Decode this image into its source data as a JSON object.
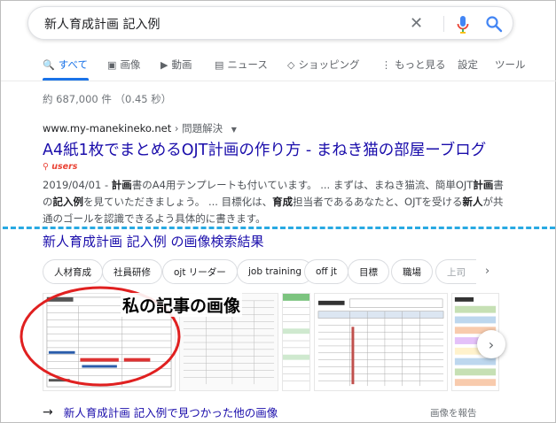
{
  "search": {
    "query": "新人育成計画 記入例",
    "clear_glyph": "✕"
  },
  "tabs": [
    {
      "label": "すべて",
      "icon": "search-icon",
      "glyph": "🔍",
      "active": true
    },
    {
      "label": "画像",
      "icon": "image-icon",
      "glyph": "▣",
      "active": false
    },
    {
      "label": "動画",
      "icon": "video-icon",
      "glyph": "▶",
      "active": false
    },
    {
      "label": "ニュース",
      "icon": "news-icon",
      "glyph": "▤",
      "active": false
    },
    {
      "label": "ショッピング",
      "icon": "tag-icon",
      "glyph": "◇",
      "active": false
    },
    {
      "label": "もっと見る",
      "icon": "more-vert-icon",
      "glyph": "⋮",
      "active": false
    },
    {
      "label": "設定",
      "active": false
    },
    {
      "label": "ツール",
      "active": false
    }
  ],
  "stats": "約 687,000 件 （0.45 秒）",
  "result": {
    "site": "www.my-manekineko.net",
    "breadcrumb": "› 問題解決",
    "caret": "▼",
    "title": "A4紙1枚でまとめるOJT計画の作り方 - まねき猫の部屋ーブログ",
    "badge": "users",
    "snippet_html": "2019/04/01 - <b>計画</b>書のA4用テンプレートも付いています。 ... まずは、まねき猫流、簡単OJT<b>計画</b>書の<b>記入例</b>を見ていただきましょう。 ... 目標化は、<b>育成</b>担当者であるあなたと、OJTを受ける<b>新人</b>が共通のゴールを認識できるよう具体的に書きます。"
  },
  "images": {
    "heading": "新人育成計画 記入例 の画像検索結果",
    "chips": [
      "人材育成",
      "社員研修",
      "ojt リーダー",
      "job training",
      "off jt",
      "目標",
      "職場",
      "上司"
    ],
    "chip_next": "›",
    "annotation": "私の記事の画像",
    "carousel_next": "›",
    "more_label": "新人育成計画 記入例で見つかった他の画像",
    "more_arrow": "→",
    "report_label": "画像を報告"
  },
  "colors": {
    "link": "#1a0dab",
    "accent": "#1a73e8",
    "annotation_red": "#e02020",
    "dashed_line": "#28a9e2"
  }
}
